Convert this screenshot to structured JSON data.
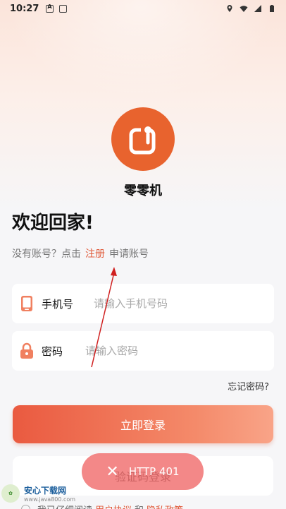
{
  "status_bar": {
    "time": "10:27"
  },
  "app": {
    "name": "零零机"
  },
  "welcome": "欢迎回家!",
  "register": {
    "prefix": "没有账号？点击",
    "link": "注册",
    "suffix": "申请账号"
  },
  "phone_field": {
    "label": "手机号",
    "placeholder": "请输入手机号码"
  },
  "password_field": {
    "label": "密码",
    "placeholder": "请输入密码"
  },
  "forgot": "忘记密码?",
  "login_button": "立即登录",
  "code_button": "验证码登录",
  "agreement": {
    "prefix": "我已仔细阅读",
    "user_agreement": "用户协议",
    "and": "和",
    "privacy": "隐私政策"
  },
  "toast": {
    "text": "HTTP 401"
  },
  "watermark": {
    "title": "安心下载网",
    "url": "www.java800.com"
  },
  "colors": {
    "accent": "#e8632e",
    "link": "#e05a3a",
    "toast": "#f06e6e"
  },
  "icons": [
    "phone-icon",
    "lock-icon",
    "close-icon",
    "location-icon",
    "wifi-icon",
    "signal-icon",
    "battery-icon"
  ]
}
